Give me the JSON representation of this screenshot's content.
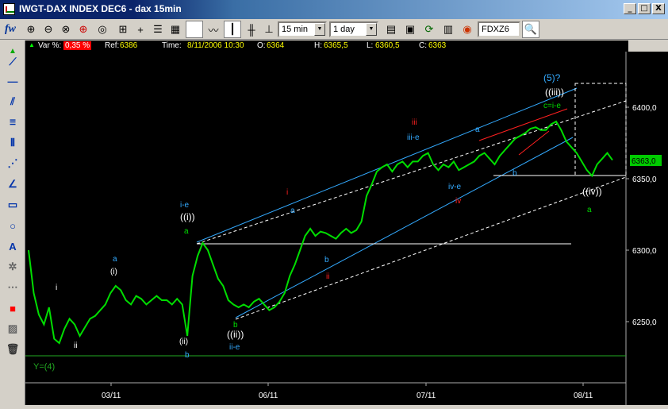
{
  "window": {
    "title": "IWGT-DAX INDEX DEC6 - dax 15min",
    "min_btn": "_",
    "max_btn": "□",
    "close_btn": "X"
  },
  "toolbar": {
    "logo": "fw",
    "interval": "15 min",
    "period": "1 day",
    "symbol": "FDXZ6"
  },
  "infobar": {
    "var_label": "Var %:",
    "var_value": "0,35 %",
    "ref_label": "Ref:",
    "ref_value": "6386",
    "time_label": "Time:",
    "time_value": "8/11/2006 10:30",
    "open_label": "O:",
    "open_value": "6364",
    "high_label": "H:",
    "high_value": "6365,5",
    "low_label": "L:",
    "low_value": "6360,5",
    "close_label": "C:",
    "close_value": "6363"
  },
  "colors": {
    "price": "#00dd00",
    "channel_blue": "#33aaff",
    "trend_red": "#ff2020",
    "support": "#ffffff",
    "y4_line": "#22aa22",
    "current_price_bg": "#00cc00"
  },
  "chart_data": {
    "type": "line",
    "title": "",
    "ylim": [
      6220,
      6420
    ],
    "y_ticks": [
      "6400,0",
      "6350,0",
      "6300,0",
      "6250,0"
    ],
    "x_ticks": [
      "03/11",
      "06/11",
      "07/11",
      "08/11"
    ],
    "current_price": "6363,0",
    "series": [
      {
        "values": [
          6300,
          6270,
          6255,
          6248,
          6260,
          6238,
          6235,
          6245,
          6252,
          6248,
          6240,
          6246,
          6252,
          6254,
          6258,
          6262,
          6270,
          6275,
          6272,
          6265,
          6262,
          6268,
          6266,
          6262,
          6265,
          6268,
          6265,
          6265,
          6262,
          6266,
          6262,
          6240,
          6282,
          6296,
          6305,
          6300,
          6290,
          6280,
          6275,
          6265,
          6262,
          6260,
          6262,
          6260,
          6264,
          6266,
          6262,
          6258,
          6260,
          6264,
          6270,
          6282,
          6290,
          6300,
          6310,
          6315,
          6310,
          6313,
          6312,
          6310,
          6308,
          6312,
          6315,
          6312,
          6314,
          6320,
          6338,
          6346,
          6355,
          6358,
          6360,
          6355,
          6360,
          6362,
          6358,
          6362,
          6362,
          6366,
          6368,
          6360,
          6356,
          6360,
          6358,
          6362,
          6356,
          6358,
          6360,
          6362,
          6366,
          6368,
          6364,
          6360,
          6366,
          6370,
          6374,
          6378,
          6380,
          6382,
          6385,
          6386,
          6384,
          6384,
          6388,
          6390,
          6384,
          6376,
          6372,
          6368,
          6362,
          6356,
          6352,
          6360,
          6364,
          6368,
          6363
        ]
      }
    ],
    "annotations": [
      "(5)?",
      "((iii))",
      "c=i-e",
      "iii",
      "iii-e",
      "a",
      "b",
      "iv-e",
      "iv",
      "i-e",
      "((i))",
      "a",
      "i",
      "a",
      "b",
      "ii",
      "a",
      "(i)",
      "i",
      "ii",
      "(ii)",
      "b",
      "((ii))",
      "ii-e",
      "b",
      "((iv))",
      "a",
      "Y=(4)"
    ]
  }
}
